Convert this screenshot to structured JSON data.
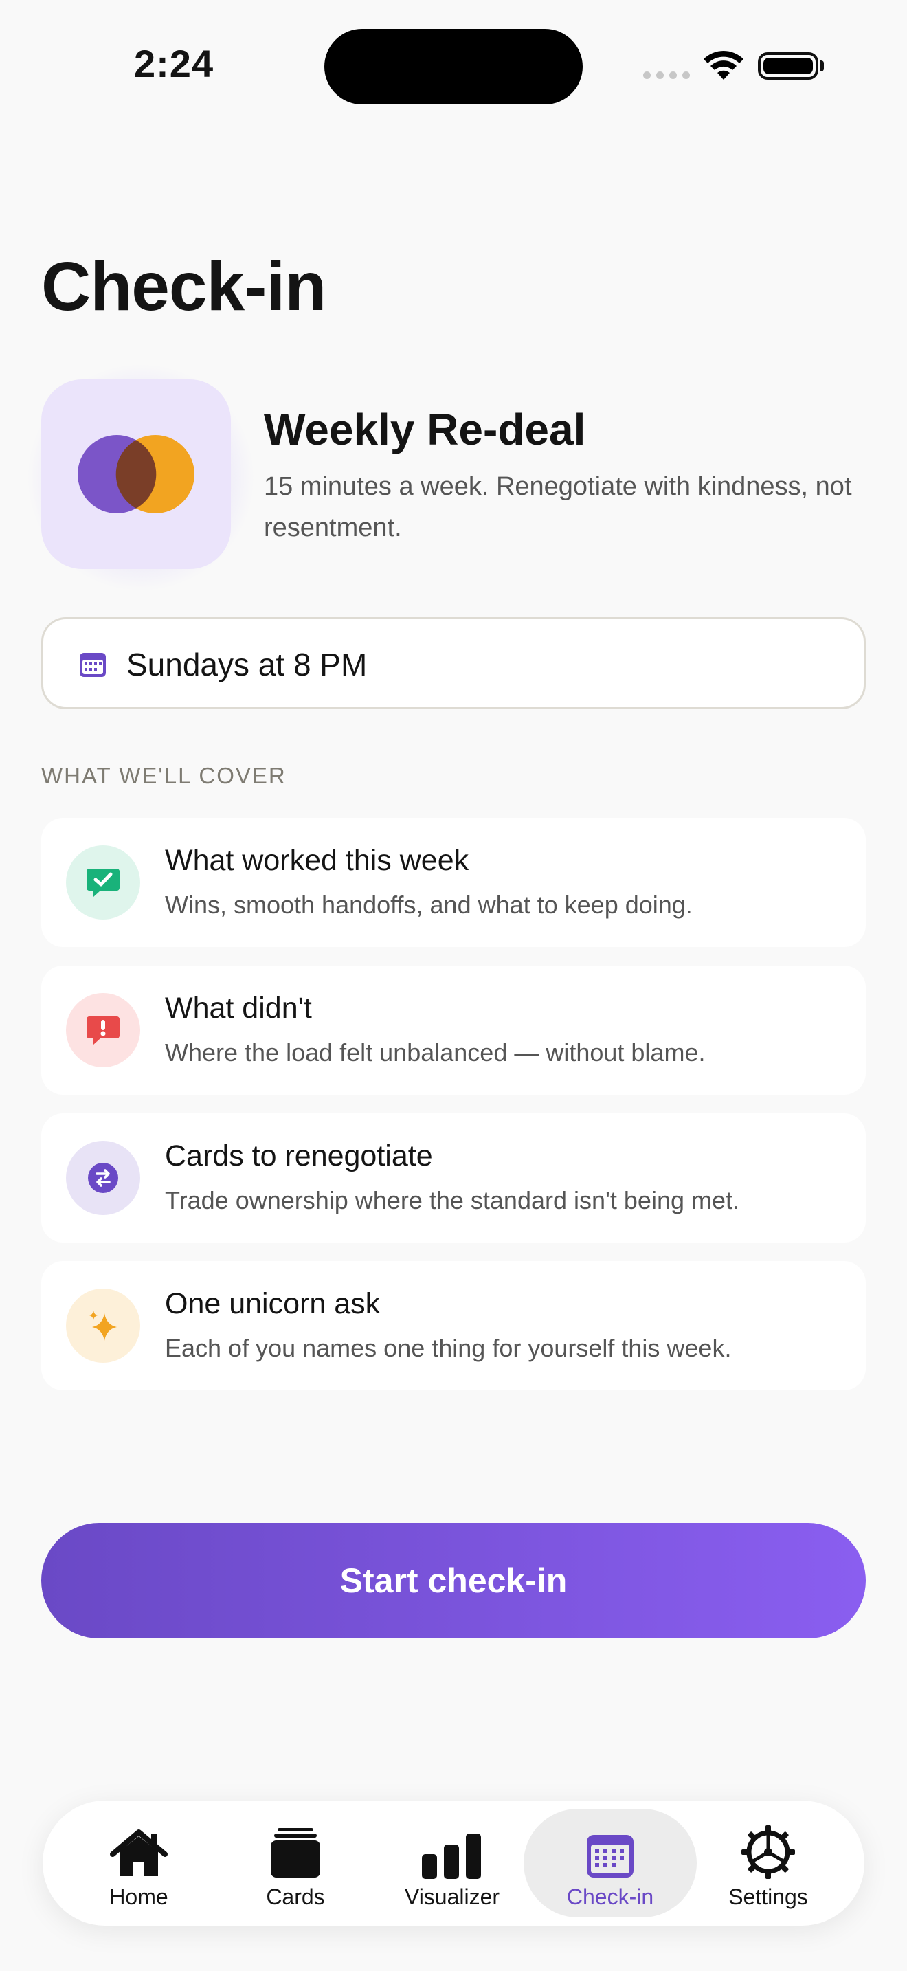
{
  "status_bar": {
    "time": "2:24"
  },
  "page": {
    "title": "Check-in"
  },
  "hero": {
    "title": "Weekly Re-deal",
    "subtitle": "15 minutes a week. Renegotiate with kindness, not resentment."
  },
  "schedule": {
    "label": "Sundays at 8 PM",
    "icon": "calendar-icon"
  },
  "section": {
    "label": "WHAT WE'LL COVER"
  },
  "cover_items": [
    {
      "title": "What worked this week",
      "description": "Wins, smooth handoffs, and what to keep doing.",
      "icon": "check-message-icon",
      "color": "#19b27a"
    },
    {
      "title": "What didn't",
      "description": "Where the load felt unbalanced — without blame.",
      "icon": "alert-message-icon",
      "color": "#e84a4a"
    },
    {
      "title": "Cards to renegotiate",
      "description": "Trade ownership where the standard isn't being met.",
      "icon": "swap-icon",
      "color": "#6a49c6"
    },
    {
      "title": "One unicorn ask",
      "description": "Each of you names one thing for yourself this week.",
      "icon": "sparkle-icon",
      "color": "#f2a421"
    }
  ],
  "cta": {
    "label": "Start check-in"
  },
  "tabs": [
    {
      "label": "Home",
      "icon": "home-icon"
    },
    {
      "label": "Cards",
      "icon": "cards-icon"
    },
    {
      "label": "Visualizer",
      "icon": "bar-chart-icon"
    },
    {
      "label": "Check-in",
      "icon": "calendar-icon",
      "active": true
    },
    {
      "label": "Settings",
      "icon": "gear-icon"
    }
  ],
  "colors": {
    "accent": "#6a49c6",
    "accent_light": "#8a5ef0",
    "background": "#f9f9f9"
  }
}
